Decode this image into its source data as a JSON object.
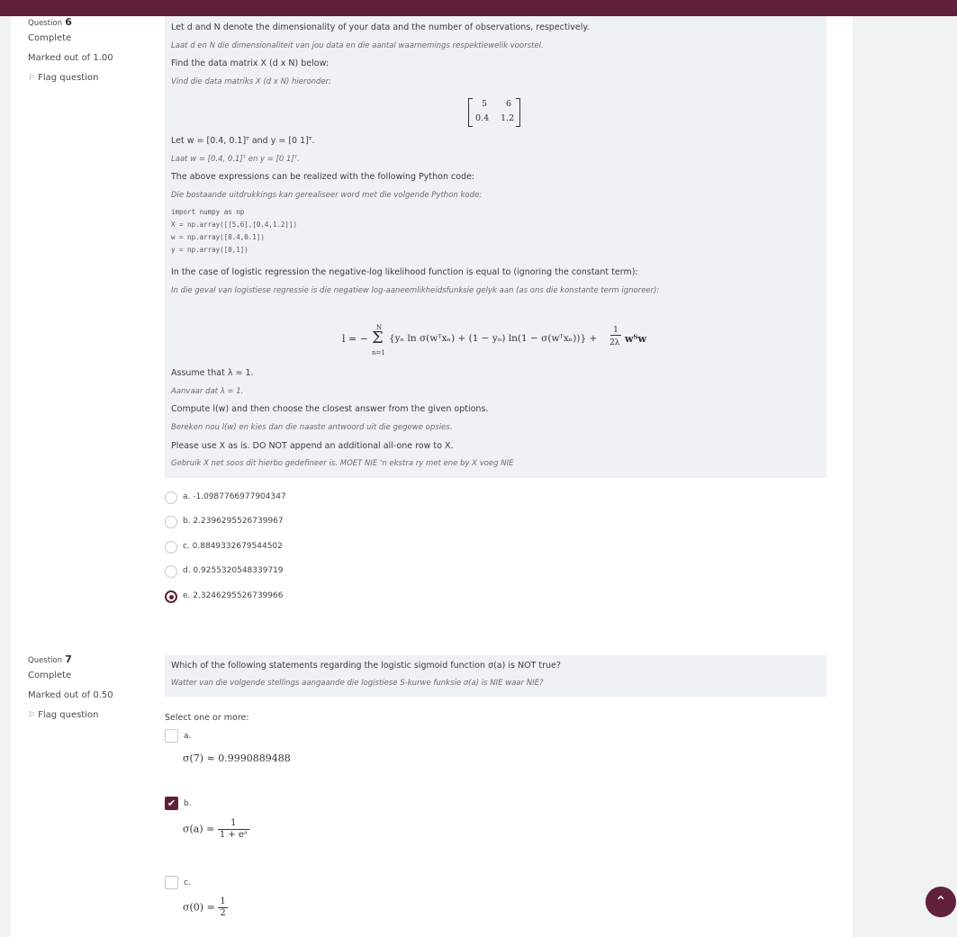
{
  "q6": {
    "label": "Question",
    "number": "6",
    "status": "Complete",
    "marked": "Marked out of 1.00",
    "flag": "Flag question",
    "lines": {
      "l1": "Let d and N denote the dimensionality of your data and the number of observations, respectively.",
      "l1_af": "Laat d en N die dimensionaliteit van jou data en die aantal waarnemings respektiewelik voorstel.",
      "l2": "Find the data matrix X (d x N) below:",
      "l2_af": "Vind die data matriks X (d x N) hieronder:",
      "l3": "Let w = [0.4, 0.1]ᵀ and y = [0 1]ᵀ.",
      "l3_af": "Laat w = [0.4, 0.1]ᵀ en y = [0 1]ᵀ.",
      "l4": "The above expressions can be realized with the following Python code:",
      "l4_af": "Die bostaande uitdrukkings kan gerealiseer word met die volgende Python kode:",
      "l5": "In the case of logistic regression the negative-log likelihood function is equal to (ignoring the constant term):",
      "l5_af": "In die geval van logistiese regressie is die negatiew log-aaneemlikheidsfunksie gelyk aan (as ons die konstante term ignoreer):",
      "l6": "Assume that λ = 1.",
      "l6_af": "Aanvaar dat λ = 1.",
      "l7": "Compute l(w) and then choose the closest answer from the given options.",
      "l7_af": "Bereken nou l(w) en kies dan die naaste antwoord uit die gegewe opsies.",
      "l8": "Please use X as is. DO NOT append an additional all-one row to X.",
      "l8_af": "Gebruik X net soos dit hierbo gedefineer is. MOET NIE 'n ekstra ry met ene by X voeg NIE"
    },
    "matrix": {
      "r1c1": "5",
      "r1c2": "6",
      "r2c1": "0.4",
      "r2c2": "1.2"
    },
    "code": "import numpy as np\nX = np.array([[5,6],[0.4,1.2]])\nw = np.array([0.4,0.1])\ny = np.array([0,1])",
    "formula": {
      "lhs": "l = −",
      "sum_top": "N",
      "sum_sym": "Σ",
      "sum_bot": "n=1",
      "body": "{yₙ ln σ(wᵀxₙ) + (1 − yₙ) ln(1 − σ(wᵀxₙ))} +",
      "frac_num": "1",
      "frac_den": "2λ",
      "tail": "wᵀw"
    },
    "options": [
      {
        "text": "a. -1.0987766977904347",
        "selected": false
      },
      {
        "text": "b. 2.2396295526739967",
        "selected": false
      },
      {
        "text": "c. 0.8849332679544502",
        "selected": false
      },
      {
        "text": "d. 0.9255320548339719",
        "selected": false
      },
      {
        "text": "e. 2.3246295526739966",
        "selected": true
      }
    ]
  },
  "q7": {
    "label": "Question",
    "number": "7",
    "status": "Complete",
    "marked": "Marked out of 0.50",
    "flag": "Flag question",
    "prompt": "Which of the following statements regarding the logistic sigmoid function σ(a) is NOT true?",
    "prompt_af": "Watter van die volgende stellings aangaande die logistiese S-kurwe funksie σ(a) is NIE waar NIE?",
    "select_hint": "Select one or more:",
    "options": [
      {
        "label": "a.",
        "expr": "σ(7) ≈ 0.9990889488",
        "checked": false
      },
      {
        "label": "b.",
        "expr_lhs": "σ(a) =",
        "num": "1",
        "den": "1 + eᵃ",
        "checked": true
      },
      {
        "label": "c.",
        "expr_lhs": "σ(0) =",
        "num": "1",
        "den": "2",
        "checked": false
      }
    ]
  },
  "colors": {
    "brand": "#60203b",
    "panel": "#eef1f5"
  },
  "icons": {
    "flag": "flag-icon",
    "scroll_top": "chevron-up-icon"
  }
}
